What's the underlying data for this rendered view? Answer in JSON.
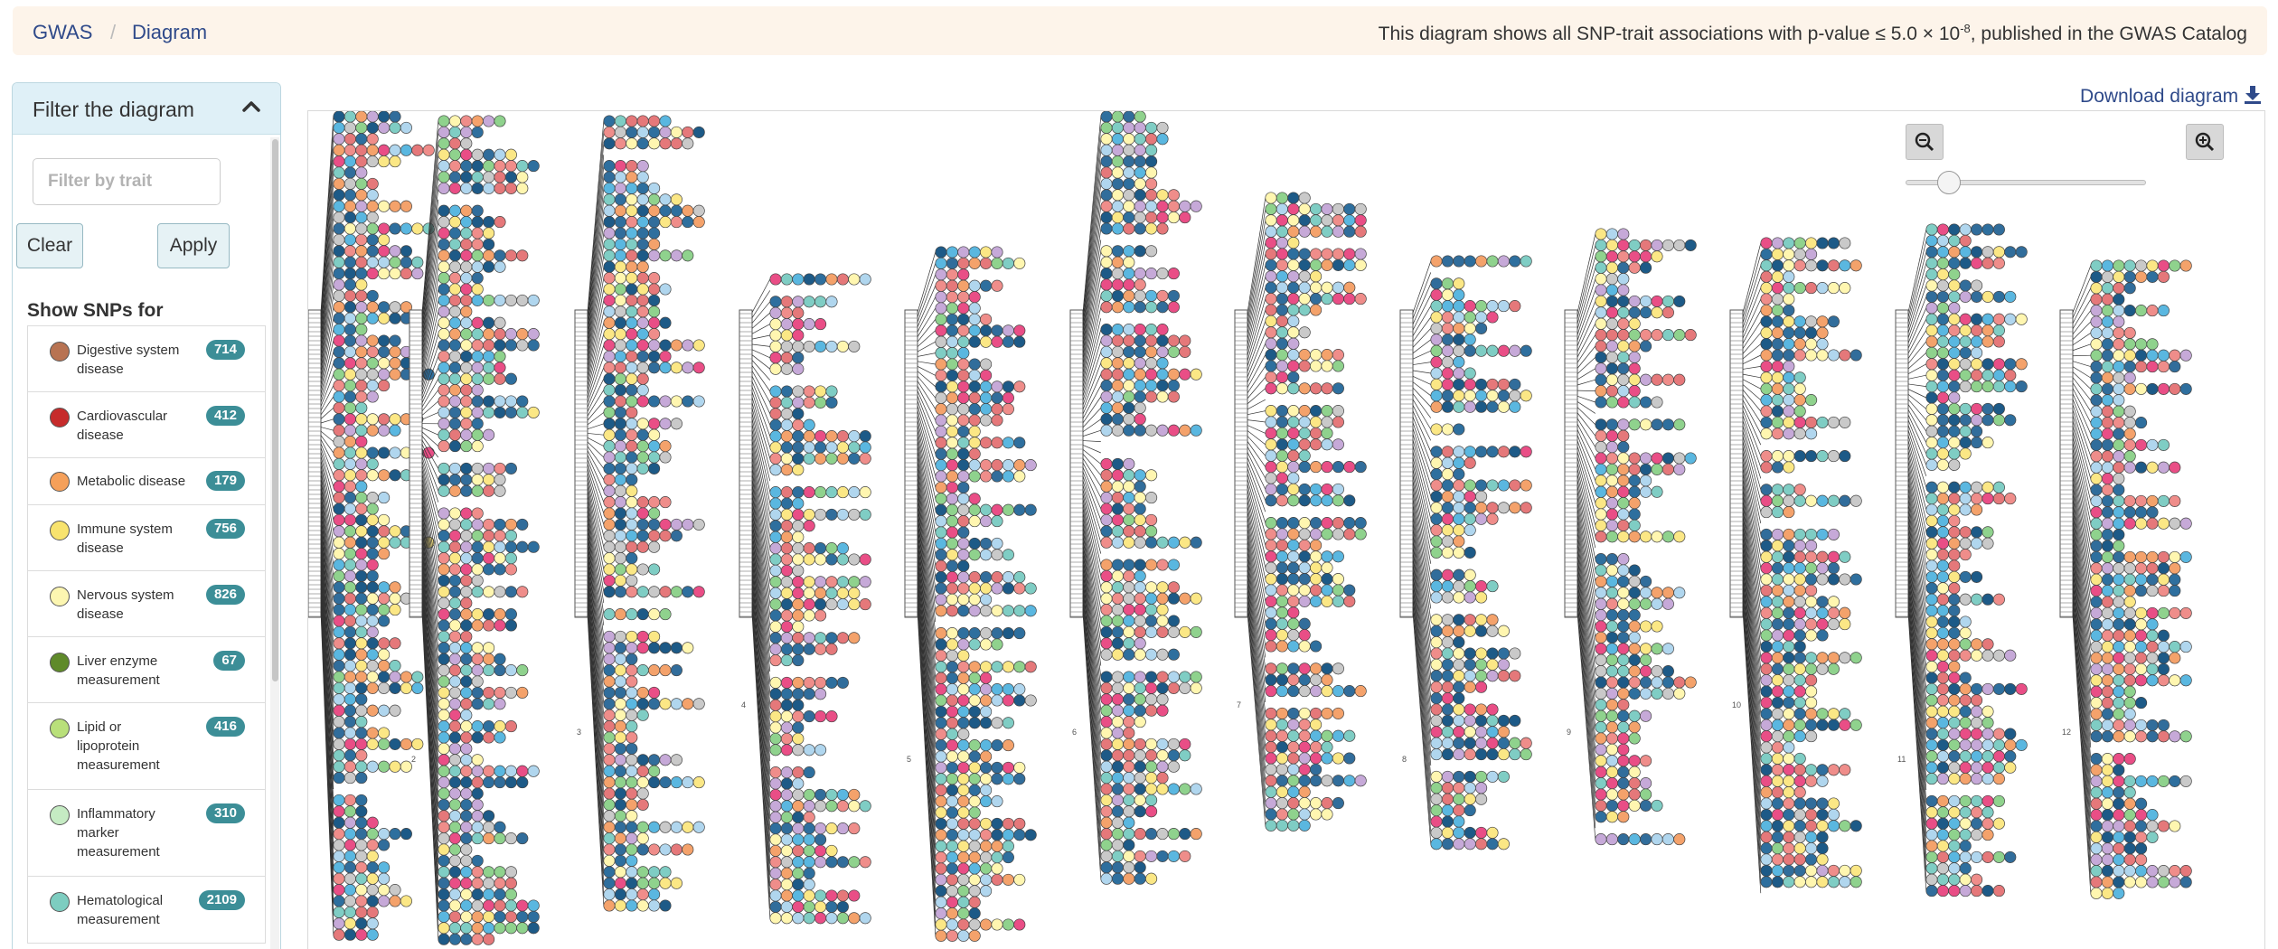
{
  "breadcrumb": {
    "home": "GWAS",
    "separator": "/",
    "current": "Diagram"
  },
  "header": {
    "message_prefix": "This diagram shows all SNP-trait associations with p-value ≤ 5.0 × 10",
    "exponent": "-8",
    "message_suffix": ", published in the GWAS Catalog"
  },
  "filter": {
    "title": "Filter the diagram",
    "collapse_icon": "chevron-up-icon",
    "trait_placeholder": "Filter by trait",
    "clear_label": "Clear",
    "apply_label": "Apply",
    "show_snps_label": "Show SNPs for",
    "items": [
      {
        "label": "Digestive system disease",
        "count": "714",
        "color": "#b87352"
      },
      {
        "label": "Cardiovascular disease",
        "count": "412",
        "color": "#c62b2b"
      },
      {
        "label": "Metabolic disease",
        "count": "179",
        "color": "#f5a05a"
      },
      {
        "label": "Immune system disease",
        "count": "756",
        "color": "#f8e36e"
      },
      {
        "label": "Nervous system disease",
        "count": "826",
        "color": "#fcf6b1"
      },
      {
        "label": "Liver enzyme measurement",
        "count": "67",
        "color": "#5f8a2a"
      },
      {
        "label": "Lipid or lipoprotein measurement",
        "count": "416",
        "color": "#b9e07a"
      },
      {
        "label": "Inflammatory marker measurement",
        "count": "310",
        "color": "#c5ebc3"
      },
      {
        "label": "Hematological measurement",
        "count": "2109",
        "color": "#7dcdc0"
      }
    ]
  },
  "download": {
    "label": "Download diagram",
    "icon": "download-icon"
  },
  "zoom": {
    "out_icon": "zoom-out-icon",
    "in_icon": "zoom-in-icon",
    "level": 0.18
  },
  "diagram": {
    "chromosome_labels": [
      "2",
      "3",
      "4",
      "5",
      "6",
      "7",
      "8",
      "9",
      "10",
      "11",
      "12"
    ],
    "colors": [
      "#2e6f9e",
      "#1d5a87",
      "#e5787a",
      "#7fcdc4",
      "#5ab7e0",
      "#fbe785",
      "#f4a26b",
      "#c6a9d8",
      "#e94e86",
      "#8fd28d",
      "#b0d6ee",
      "#c9c9c9",
      "#fff6b0",
      "#316d9b",
      "#ef8d8a"
    ]
  }
}
